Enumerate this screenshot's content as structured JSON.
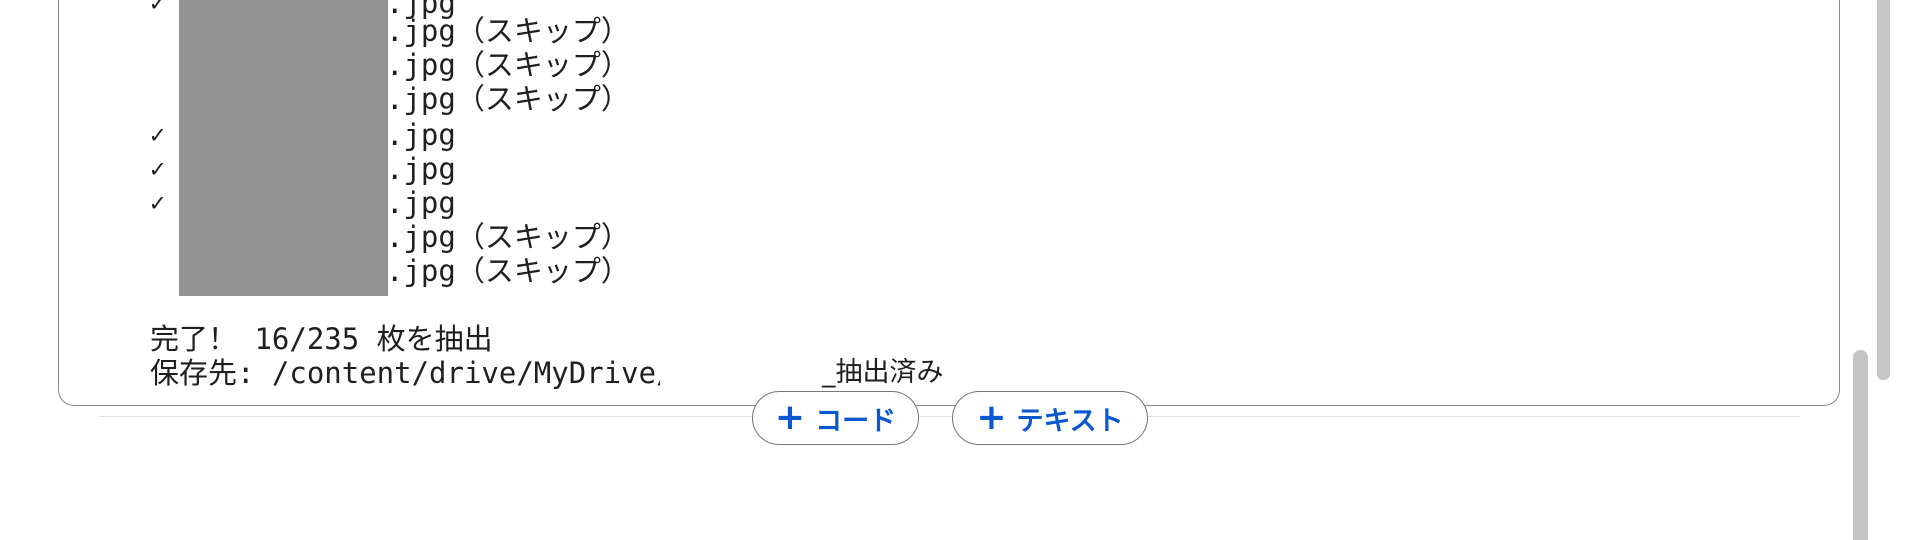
{
  "output": {
    "rows": [
      {
        "check": "✓",
        "text": ".jpg"
      },
      {
        "check": "",
        "text": ".jpg（スキップ）"
      },
      {
        "check": "",
        "text": ".jpg（スキップ）"
      },
      {
        "check": "",
        "text": ".jpg（スキップ）"
      },
      {
        "check": "✓",
        "text": ".jpg"
      },
      {
        "check": "✓",
        "text": ".jpg"
      },
      {
        "check": "✓",
        "text": ".jpg"
      },
      {
        "check": "",
        "text": ".jpg（スキップ）"
      },
      {
        "check": "",
        "text": ".jpg（スキップ）"
      }
    ],
    "summary": "完了！ 16/235 枚を抽出",
    "save_path_prefix": "保存先: /content/drive/MyDrive/",
    "save_path_suffix": "_抽出済み"
  },
  "toolbar": {
    "add_code_label": "コード",
    "add_text_label": "テキスト",
    "accent_color": "#0b57d0"
  },
  "icons": {
    "check_icon": "check-icon",
    "plus_icon": "plus-icon"
  }
}
